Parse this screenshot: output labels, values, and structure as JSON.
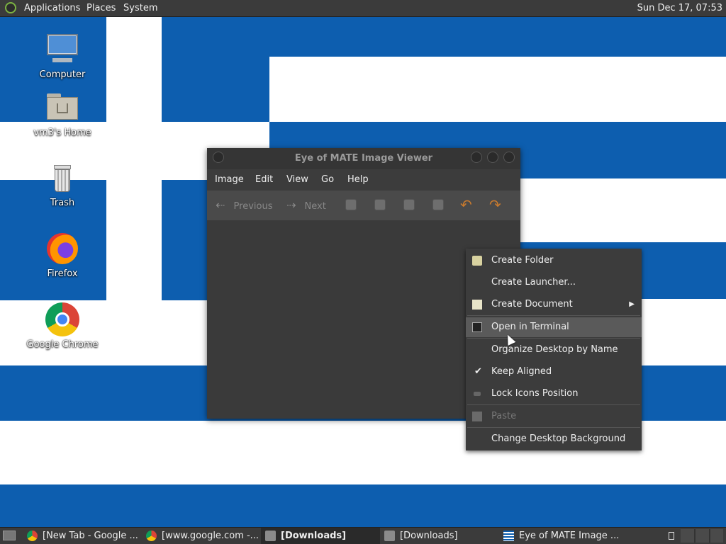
{
  "top_panel": {
    "menu": [
      "Applications",
      "Places",
      "System"
    ],
    "clock": "Sun Dec 17, 07:53"
  },
  "desktop_icons": [
    {
      "label": "Computer",
      "icon": "computer-icon"
    },
    {
      "label": "vm3's Home",
      "icon": "home-folder-icon"
    },
    {
      "label": "Trash",
      "icon": "trash-icon"
    },
    {
      "label": "Firefox",
      "icon": "firefox-icon"
    },
    {
      "label": "Google Chrome",
      "icon": "chrome-icon"
    }
  ],
  "viewer": {
    "title": "Eye of MATE Image Viewer",
    "menu": [
      "Image",
      "Edit",
      "View",
      "Go",
      "Help"
    ],
    "toolbar": {
      "previous": "Previous",
      "next": "Next"
    }
  },
  "context_menu": {
    "items": [
      {
        "label": "Create Folder",
        "icon": "folder-new-icon"
      },
      {
        "label": "Create Launcher..."
      },
      {
        "label": "Create Document",
        "icon": "document-new-icon",
        "submenu": true
      },
      {
        "label": "Open in Terminal",
        "icon": "terminal-icon",
        "highlighted": true
      },
      {
        "label": "Organize Desktop by Name"
      },
      {
        "label": "Keep Aligned",
        "checked": true
      },
      {
        "label": "Lock Icons Position"
      },
      {
        "label": "Paste",
        "disabled": true,
        "icon": "paste-icon"
      },
      {
        "label": "Change Desktop Background"
      }
    ]
  },
  "taskbar": [
    {
      "label": "[New Tab - Google ...",
      "icon": "chrome-icon"
    },
    {
      "label": "[www.google.com -...",
      "icon": "chrome-icon"
    },
    {
      "label": "[Downloads]",
      "icon": "folder-icon",
      "active": true
    },
    {
      "label": "[Downloads]",
      "icon": "folder-icon"
    },
    {
      "label": "Eye of MATE Image ...",
      "icon": "image-viewer-icon"
    }
  ],
  "colors": {
    "flag_blue": "#0d5eaf",
    "panel": "#3b3b3b",
    "menu_bg": "#3c3c3c"
  }
}
